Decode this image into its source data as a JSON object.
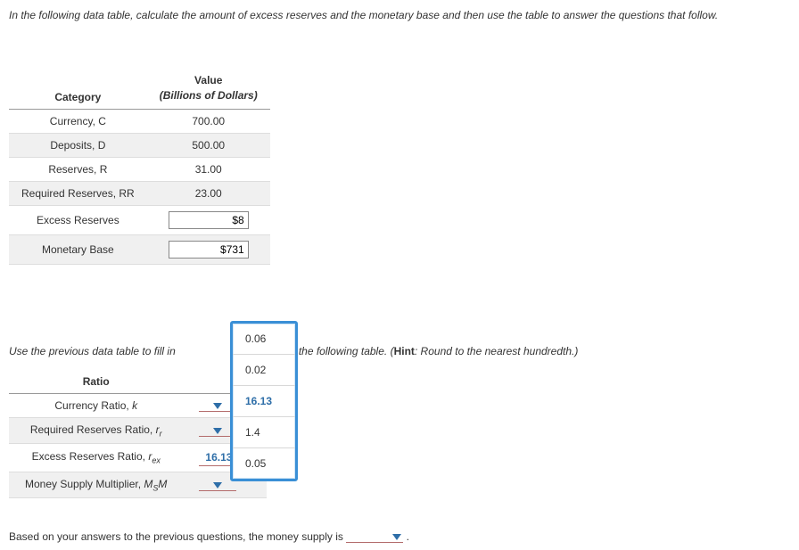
{
  "intro": "In the following data table, calculate the amount of excess reserves and the monetary base and then use the table to answer the questions that follow.",
  "table1": {
    "header_category": "Category",
    "header_value_top": "Value",
    "header_value_sub": "(Billions of Dollars)",
    "rows": [
      {
        "label": "Currency, C",
        "value": "700.00"
      },
      {
        "label": "Deposits, D",
        "value": "500.00"
      },
      {
        "label": "Reserves, R",
        "value": "31.00"
      },
      {
        "label": "Required Reserves, RR",
        "value": "23.00"
      }
    ],
    "excess_label": "Excess Reserves",
    "excess_value": "$8",
    "mbase_label": "Monetary Base",
    "mbase_value": "$731"
  },
  "mid_text_a": "Use the previous data table to fill in",
  "mid_text_b": "ing cells in the following table. (",
  "mid_text_hint": "Hint",
  "mid_text_c": ": Round to the nearest hundredth.)",
  "dropdown_options": [
    "0.06",
    "0.02",
    "16.13",
    "1.4",
    "0.05"
  ],
  "dropdown_selected": "16.13",
  "table2": {
    "header": "Ratio",
    "rows": [
      {
        "label_html": "Currency Ratio, <span class='ital-var'>k</span>",
        "value": ""
      },
      {
        "label_html": "Required Reserves Ratio, <span class='ital-var'>r</span><span class='sub'>r</span>",
        "value": ""
      },
      {
        "label_html": "Excess Reserves Ratio, <span class='ital-var'>r</span><span class='sub'>ex</span>",
        "value": "16.13"
      },
      {
        "label_html": "Money Supply Multiplier, <span class='ital-var'>M</span><span class='sub'>S</span><span class='ital-var'>M</span>",
        "value": ""
      }
    ]
  },
  "final_text": "Based on your answers to the previous questions, the money supply is",
  "final_period": "."
}
